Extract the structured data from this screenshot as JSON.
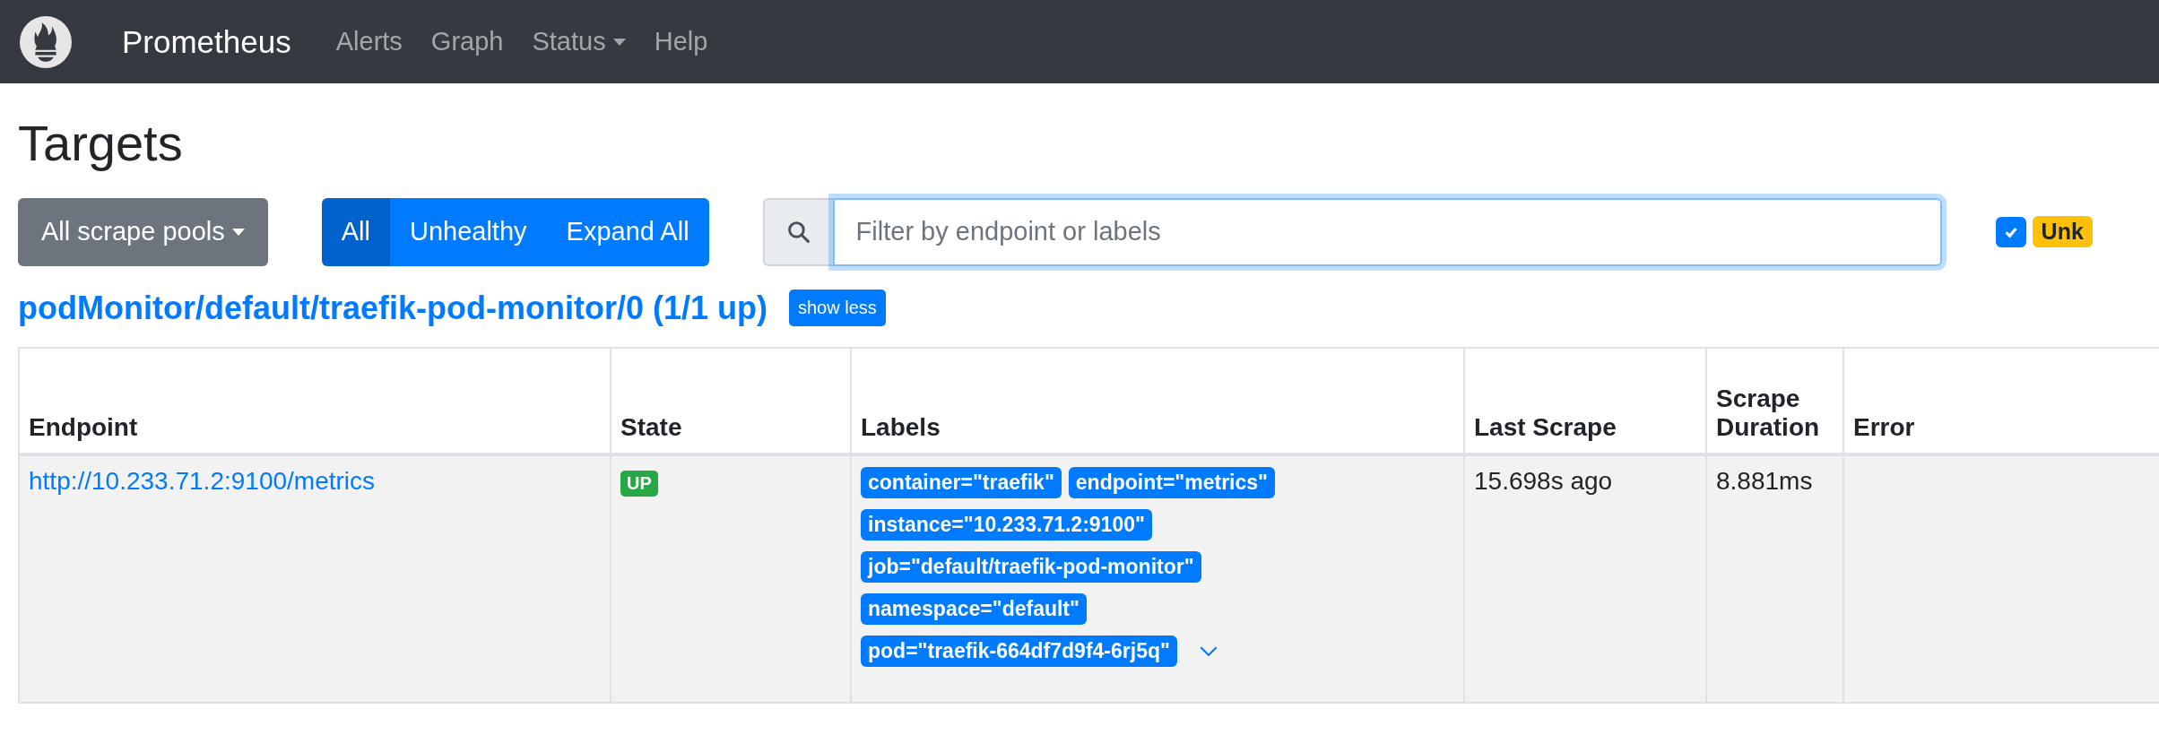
{
  "navbar": {
    "brand": "Prometheus",
    "links": [
      {
        "label": "Alerts",
        "dropdown": false
      },
      {
        "label": "Graph",
        "dropdown": false
      },
      {
        "label": "Status",
        "dropdown": true
      },
      {
        "label": "Help",
        "dropdown": false
      }
    ]
  },
  "page_title": "Targets",
  "toolbar": {
    "pool_dropdown": "All scrape pools",
    "filter_buttons": [
      {
        "label": "All",
        "selected": true
      },
      {
        "label": "Unhealthy",
        "selected": false
      },
      {
        "label": "Expand All",
        "selected": false
      }
    ],
    "search": {
      "placeholder": "Filter by endpoint or labels"
    },
    "state_filter": {
      "checked": true,
      "kind": "unknown",
      "label": "Unk"
    }
  },
  "pool": {
    "title": "podMonitor/default/traefik-pod-monitor/0 (1/1 up)",
    "toggle": "show less"
  },
  "table": {
    "columns": [
      "Endpoint",
      "State",
      "Labels",
      "Last Scrape",
      "Scrape Duration",
      "Error"
    ],
    "rows": [
      {
        "endpoint": "http://10.233.71.2:9100/metrics",
        "state": "UP",
        "kind": "up",
        "labels": [
          "container=\"traefik\"",
          "endpoint=\"metrics\"",
          "instance=\"10.233.71.2:9100\"",
          "job=\"default/traefik-pod-monitor\"",
          "namespace=\"default\"",
          "pod=\"traefik-664df7d9f4-6rj5q\""
        ],
        "last_scrape": "15.698s ago",
        "duration": "8.881ms"
      }
    ]
  }
}
